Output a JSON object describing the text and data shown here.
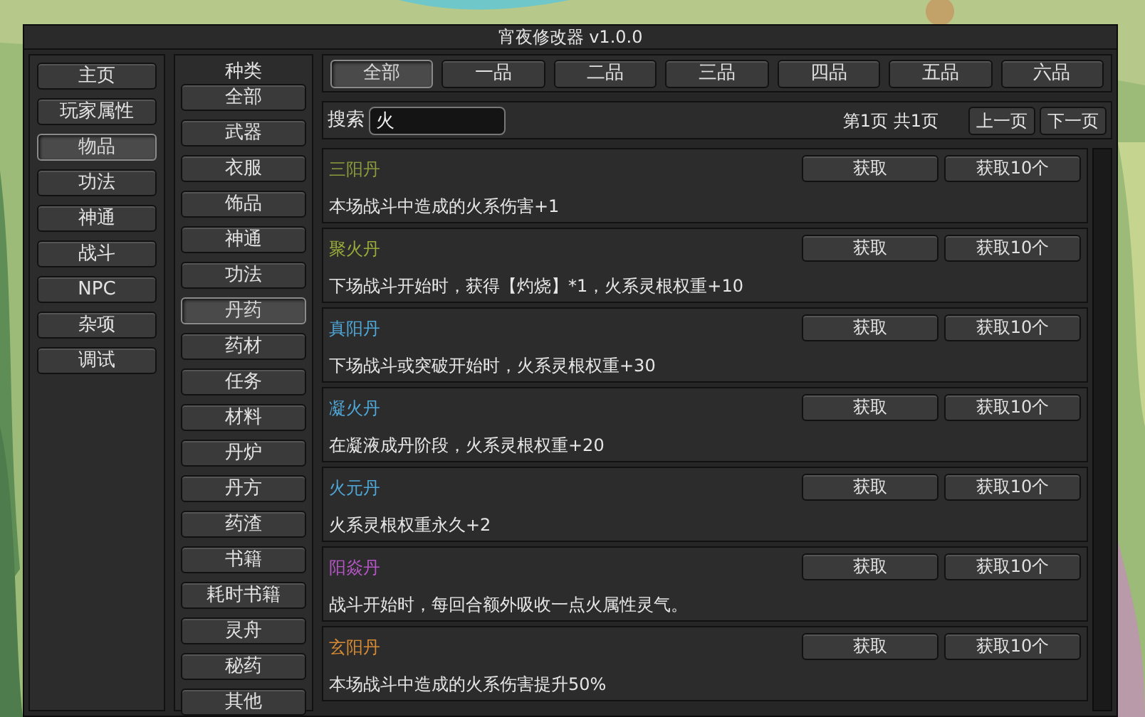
{
  "window": {
    "title": "宵夜修改器 v1.0.0"
  },
  "nav": [
    {
      "label": "主页",
      "selected": false
    },
    {
      "label": "玩家属性",
      "selected": false
    },
    {
      "label": "物品",
      "selected": true
    },
    {
      "label": "功法",
      "selected": false
    },
    {
      "label": "神通",
      "selected": false
    },
    {
      "label": "战斗",
      "selected": false
    },
    {
      "label": "NPC",
      "selected": false
    },
    {
      "label": "杂项",
      "selected": false
    },
    {
      "label": "调试",
      "selected": false
    }
  ],
  "categories": {
    "heading": "种类",
    "items": [
      {
        "label": "全部",
        "selected": false
      },
      {
        "label": "武器",
        "selected": false
      },
      {
        "label": "衣服",
        "selected": false
      },
      {
        "label": "饰品",
        "selected": false
      },
      {
        "label": "神通",
        "selected": false
      },
      {
        "label": "功法",
        "selected": false
      },
      {
        "label": "丹药",
        "selected": true
      },
      {
        "label": "药材",
        "selected": false
      },
      {
        "label": "任务",
        "selected": false
      },
      {
        "label": "材料",
        "selected": false
      },
      {
        "label": "丹炉",
        "selected": false
      },
      {
        "label": "丹方",
        "selected": false
      },
      {
        "label": "药渣",
        "selected": false
      },
      {
        "label": "书籍",
        "selected": false
      },
      {
        "label": "耗时书籍",
        "selected": false
      },
      {
        "label": "灵舟",
        "selected": false
      },
      {
        "label": "秘药",
        "selected": false
      },
      {
        "label": "其他",
        "selected": false
      }
    ]
  },
  "grades": [
    {
      "label": "全部",
      "selected": true
    },
    {
      "label": "一品",
      "selected": false
    },
    {
      "label": "二品",
      "selected": false
    },
    {
      "label": "三品",
      "selected": false
    },
    {
      "label": "四品",
      "selected": false
    },
    {
      "label": "五品",
      "selected": false
    },
    {
      "label": "六品",
      "selected": false
    }
  ],
  "search": {
    "label": "搜索",
    "value": "火"
  },
  "pagination": {
    "info": "第1页 共1页",
    "prev": "上一页",
    "next": "下一页"
  },
  "items": [
    {
      "name": "三阳丹",
      "color": "#8a9a3c",
      "description": "本场战斗中造成的火系伤害+1",
      "buttons": [
        "获取",
        "获取10个"
      ]
    },
    {
      "name": "聚火丹",
      "color": "#98ab3a",
      "description": "下场战斗开始时，获得【灼烧】*1，火系灵根权重+10",
      "buttons": [
        "获取",
        "获取10个"
      ]
    },
    {
      "name": "真阳丹",
      "color": "#4fa6d6",
      "description": "下场战斗或突破开始时，火系灵根权重+30",
      "buttons": [
        "获取",
        "获取10个"
      ]
    },
    {
      "name": "凝火丹",
      "color": "#4fa6d6",
      "description": "在凝液成丹阶段，火系灵根权重+20",
      "buttons": [
        "获取",
        "获取10个"
      ]
    },
    {
      "name": "火元丹",
      "color": "#4fa6d6",
      "description": "火系灵根权重永久+2",
      "buttons": [
        "获取",
        "获取10个"
      ]
    },
    {
      "name": "阳焱丹",
      "color": "#b455c4",
      "description": "战斗开始时，每回合额外吸收一点火属性灵气。",
      "buttons": [
        "获取",
        "获取10个"
      ]
    },
    {
      "name": "玄阳丹",
      "color": "#d68a34",
      "description": "本场战斗中造成的火系伤害提升50%",
      "buttons": [
        "获取",
        "获取10个"
      ]
    }
  ]
}
